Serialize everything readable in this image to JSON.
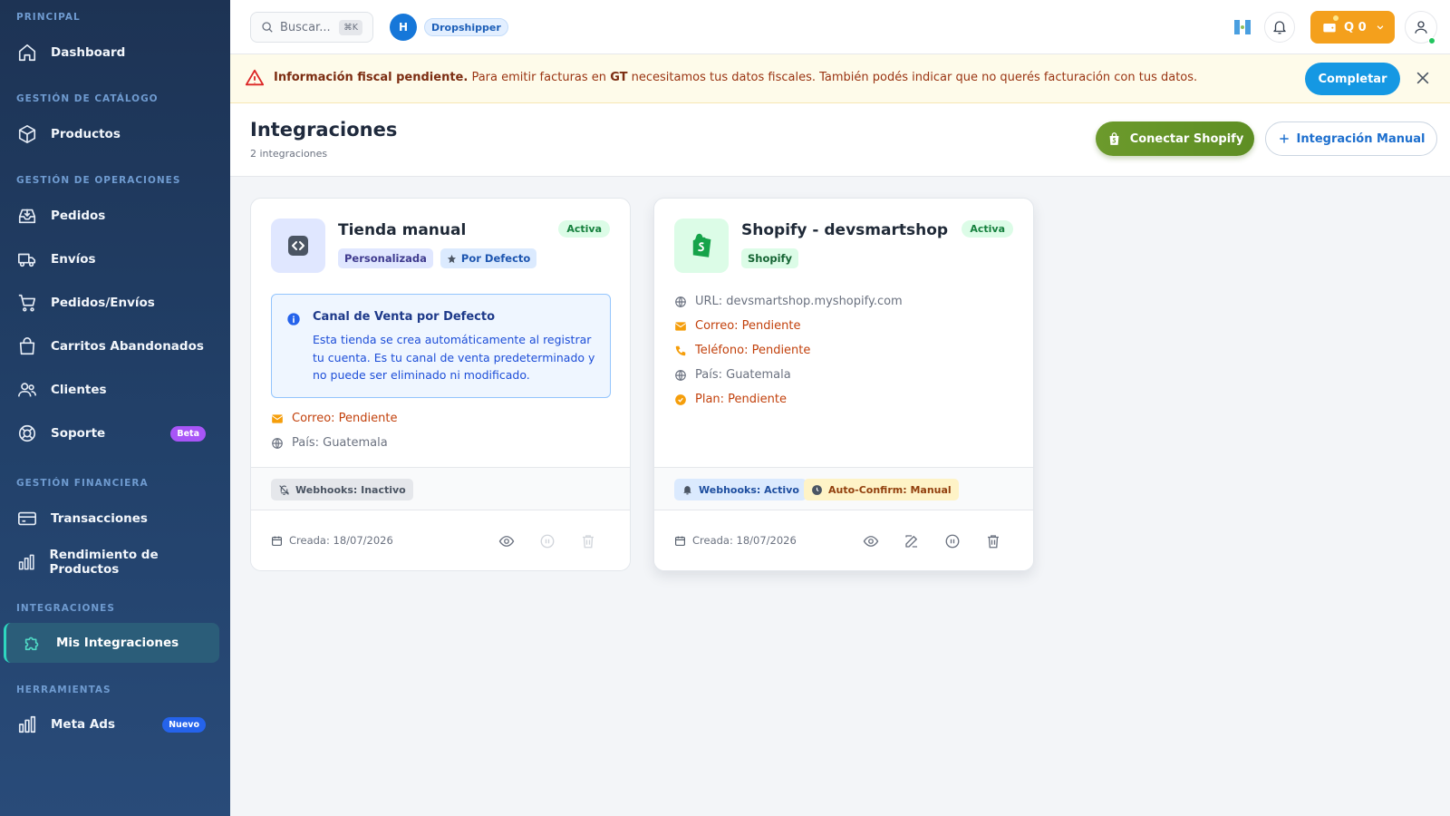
{
  "sidebar": {
    "sections": [
      {
        "title": "PRINCIPAL"
      },
      {
        "title": "GESTIÓN DE CATÁLOGO"
      },
      {
        "title": "GESTIÓN DE OPERACIONES"
      },
      {
        "title": "GESTIÓN FINANCIERA"
      },
      {
        "title": "INTEGRACIONES"
      },
      {
        "title": "HERRAMIENTAS"
      }
    ],
    "items": [
      {
        "label": "Dashboard",
        "icon": "home-icon"
      },
      {
        "label": "Productos",
        "icon": "cube-icon"
      },
      {
        "label": "Pedidos",
        "icon": "inbox-download-icon"
      },
      {
        "label": "Envíos",
        "icon": "truck-icon"
      },
      {
        "label": "Pedidos/Envíos",
        "icon": "cart-icon"
      },
      {
        "label": "Carritos Abandonados",
        "icon": "shopping-bag-icon"
      },
      {
        "label": "Clientes",
        "icon": "users-icon"
      },
      {
        "label": "Soporte",
        "icon": "lifebuoy-icon",
        "badge": "Beta"
      },
      {
        "label": "Transacciones",
        "icon": "credit-card-icon"
      },
      {
        "label": "Rendimiento de Productos",
        "icon": "bar-chart-icon"
      },
      {
        "label": "Mis Integraciones",
        "icon": "puzzle-icon",
        "active": true
      },
      {
        "label": "Meta Ads",
        "icon": "bar-chart-icon",
        "badge": "Nuevo"
      }
    ],
    "badge_colors": {
      "beta": "#a855f7",
      "nuevo": "#2563eb"
    }
  },
  "topbar": {
    "search_placeholder": "Buscar...",
    "search_shortcut": "⌘K",
    "user_initial": "H",
    "role": "Dropshipper",
    "wallet_label": "Q 0"
  },
  "banner": {
    "title": "Información fiscal pendiente.",
    "text_part1": "Para emitir facturas en",
    "country": "GT",
    "text_part2": "necesitamos tus datos fiscales. También podés indicar que no querés facturación con tus datos.",
    "button": "Completar"
  },
  "page": {
    "title": "Integraciones",
    "subtitle": "2 integraciones",
    "connect_shopify": "Conectar Shopify",
    "manual_integration": "Integración Manual"
  },
  "cards": [
    {
      "title": "Tienda manual",
      "status": "Activa",
      "tags": [
        "Personalizada",
        "Por Defecto"
      ],
      "info_title": "Canal de Venta por Defecto",
      "info_body": "Esta tienda se crea automáticamente al registrar tu cuenta. Es tu canal de venta predeterminado y no puede ser eliminado ni modificado.",
      "details": [
        "Correo: Pendiente",
        "País: Guatemala"
      ],
      "webhooks": "Webhooks: Inactivo",
      "created": "Creada: 18/07/2026"
    },
    {
      "title": "Shopify - devsmartshop",
      "status": "Activa",
      "tags": [
        "Shopify"
      ],
      "details": [
        "URL: devsmartshop.myshopify.com",
        "Correo: Pendiente",
        "Teléfono: Pendiente",
        "País: Guatemala",
        "Plan: Pendiente"
      ],
      "webhooks": "Webhooks: Activo",
      "auto_confirm": "Auto-Confirm: Manual",
      "created": "Creada: 18/07/2026"
    }
  ],
  "colors": {
    "accent_blue": "#1598e3",
    "shopify_green": "#6c9a2c",
    "wallet_orange": "#f4a01c",
    "active_teal": "#2ed6c0",
    "warning_orange": "#c2410c"
  }
}
